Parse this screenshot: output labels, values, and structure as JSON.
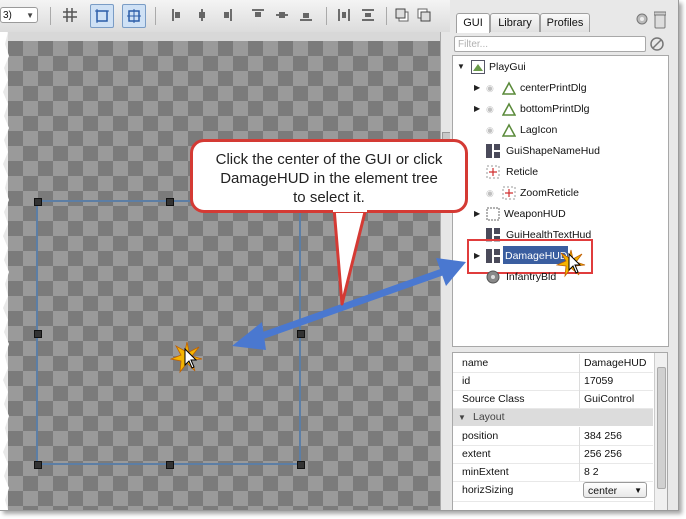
{
  "toolbar": {
    "zoom_value": "3)"
  },
  "panel": {
    "tabs": [
      "GUI",
      "Library",
      "Profiles"
    ],
    "filter_placeholder": "Filter...",
    "tree": [
      {
        "label": "PlayGui",
        "icon": "play-gui-icon"
      },
      {
        "label": "centerPrintDlg",
        "icon": "bitmap-icon"
      },
      {
        "label": "bottomPrintDlg",
        "icon": "bitmap-icon"
      },
      {
        "label": "LagIcon",
        "icon": "bitmap-icon"
      },
      {
        "label": "GuiShapeNameHud",
        "icon": "hud-icon"
      },
      {
        "label": "Reticle",
        "icon": "crosshair-icon"
      },
      {
        "label": "ZoomReticle",
        "icon": "crosshair-icon"
      },
      {
        "label": "WeaponHUD",
        "icon": "frame-icon"
      },
      {
        "label": "GuiHealthTextHud",
        "icon": "hud-icon"
      },
      {
        "label": "DamageHUD",
        "icon": "hud-icon"
      },
      {
        "label": "InfantryBld",
        "icon": "infantry-icon"
      }
    ]
  },
  "inspector": {
    "rows": [
      {
        "key": "name",
        "value": "DamageHUD"
      },
      {
        "key": "id",
        "value": "17059"
      },
      {
        "key": "Source Class",
        "value": "GuiControl"
      }
    ],
    "section": "Layout",
    "layout_rows": [
      {
        "key": "position",
        "value": "384 256"
      },
      {
        "key": "extent",
        "value": "256 256"
      },
      {
        "key": "minExtent",
        "value": "8 2"
      },
      {
        "key": "horizSizing",
        "value": "center"
      }
    ]
  },
  "callout": {
    "line1": "Click the center of the GUI or click",
    "line2": "DamageHUD in the element tree",
    "line3": "to select it."
  },
  "colors": {
    "callout_border": "#d43a34",
    "arrow": "#4a78d0",
    "selection": "#5c7ea5",
    "tree_selection": "#3a5ea0"
  }
}
